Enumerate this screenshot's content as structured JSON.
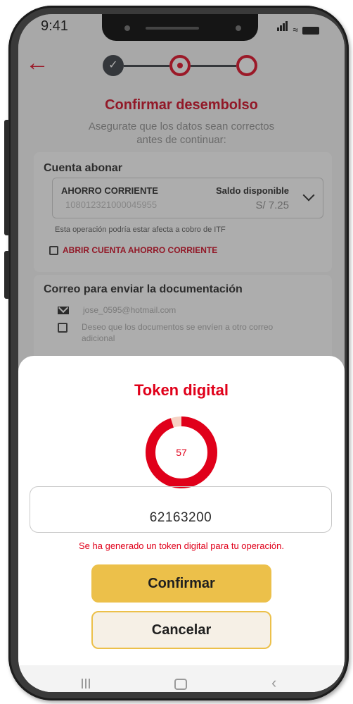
{
  "status_bar": {
    "time": "9:41"
  },
  "header": {
    "back_icon": "arrow-left-icon",
    "title": "Confirmar desembolso",
    "subtitle": "Asegurate que los datos sean correctos antes de continuar:"
  },
  "stepper": {
    "steps": [
      "done",
      "current",
      "pending"
    ]
  },
  "account": {
    "section_title": "Cuenta abonar",
    "type": "AHORRO CORRIENTE",
    "number": "108012321000045955",
    "balance_label": "Saldo disponible",
    "balance_value": "S/ 7.25",
    "itf_note": "Esta operación podría estar afecta a cobro de ITF",
    "open_account_label": "ABRIR CUENTA AHORRO CORRIENTE"
  },
  "mail": {
    "section_title": "Correo para enviar la documentación",
    "email": "jose_0595@hotmail.com",
    "other_mail_label": "Deseo que los documentos se envíen a otro correo adicional"
  },
  "token_sheet": {
    "title": "Token digital",
    "countdown": "57",
    "countdown_fraction": 0.95,
    "token_value": "62163200",
    "message": "Se ha generado un token digital para tu operación.",
    "confirm_label": "Confirmar",
    "cancel_label": "Cancelar"
  },
  "colors": {
    "brand_red": "#e0001a",
    "button_yellow": "#ecc04a",
    "cancel_bg": "#f6f0e6"
  }
}
